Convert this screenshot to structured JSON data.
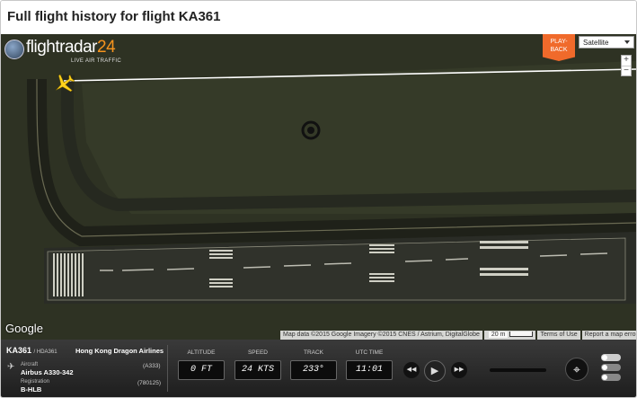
{
  "page": {
    "title": "Full flight history for flight KA361"
  },
  "map": {
    "logo_text": "flightradar",
    "logo_number": "24",
    "logo_subtitle": "LIVE AIR TRAFFIC",
    "playback_label_1": "PLAY-",
    "playback_label_2": "BACK",
    "map_type": "Satellite",
    "zoom_in": "+",
    "zoom_out": "−",
    "google_logo": "Google",
    "attribution": "Map data ©2015 Google Imagery ©2015 CNES / Astrium, DigitalGlobe",
    "scale_label": "20 m",
    "terms": "Terms of Use",
    "report": "Report a map error"
  },
  "flight": {
    "callsign": "KA361",
    "icao_callsign": "/ HDA361",
    "airline": "Hong Kong Dragon Airlines",
    "aircraft_label": "Aircraft",
    "aircraft_type": "Airbus A330-342",
    "aircraft_code": "(A333)",
    "registration_label": "Registration",
    "registration": "B-HLB",
    "registration_code": "(780125)"
  },
  "gauges": {
    "altitude_label": "ALTITUDE",
    "altitude_value": "0 FT",
    "speed_label": "SPEED",
    "speed_value": "24 KTS",
    "track_label": "TRACK",
    "track_value": "233°",
    "utc_label": "UTC TIME",
    "utc_value": "11:01"
  },
  "controls": {
    "rewind_icon": "rewind-icon",
    "play_icon": "play-icon",
    "forward_icon": "fast-forward-icon",
    "target_icon": "crosshair-icon",
    "playback_progress": 0
  },
  "colors": {
    "accent": "#f06a2b",
    "logo_number": "#f7941d",
    "panel_bg": "#2a2a2a"
  }
}
